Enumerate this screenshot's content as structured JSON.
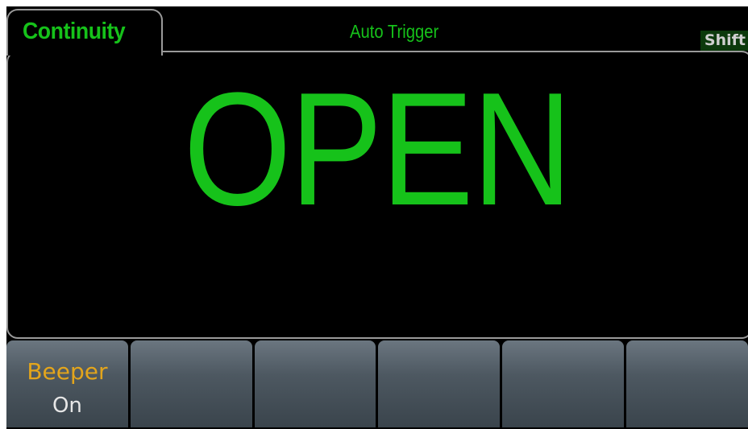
{
  "header": {
    "function_tab": "Continuity",
    "trigger_mode": "Auto Trigger",
    "shift_indicator": "Shift"
  },
  "display": {
    "reading": "OPEN"
  },
  "softkeys": [
    {
      "title": "Beeper",
      "value": "On"
    },
    {
      "title": "",
      "value": ""
    },
    {
      "title": "",
      "value": ""
    },
    {
      "title": "",
      "value": ""
    },
    {
      "title": "",
      "value": ""
    },
    {
      "title": "",
      "value": ""
    }
  ],
  "colors": {
    "accent_green": "#16c21a",
    "softkey_title": "#e3a51c",
    "background": "#000000",
    "border": "#9a9a9a"
  }
}
